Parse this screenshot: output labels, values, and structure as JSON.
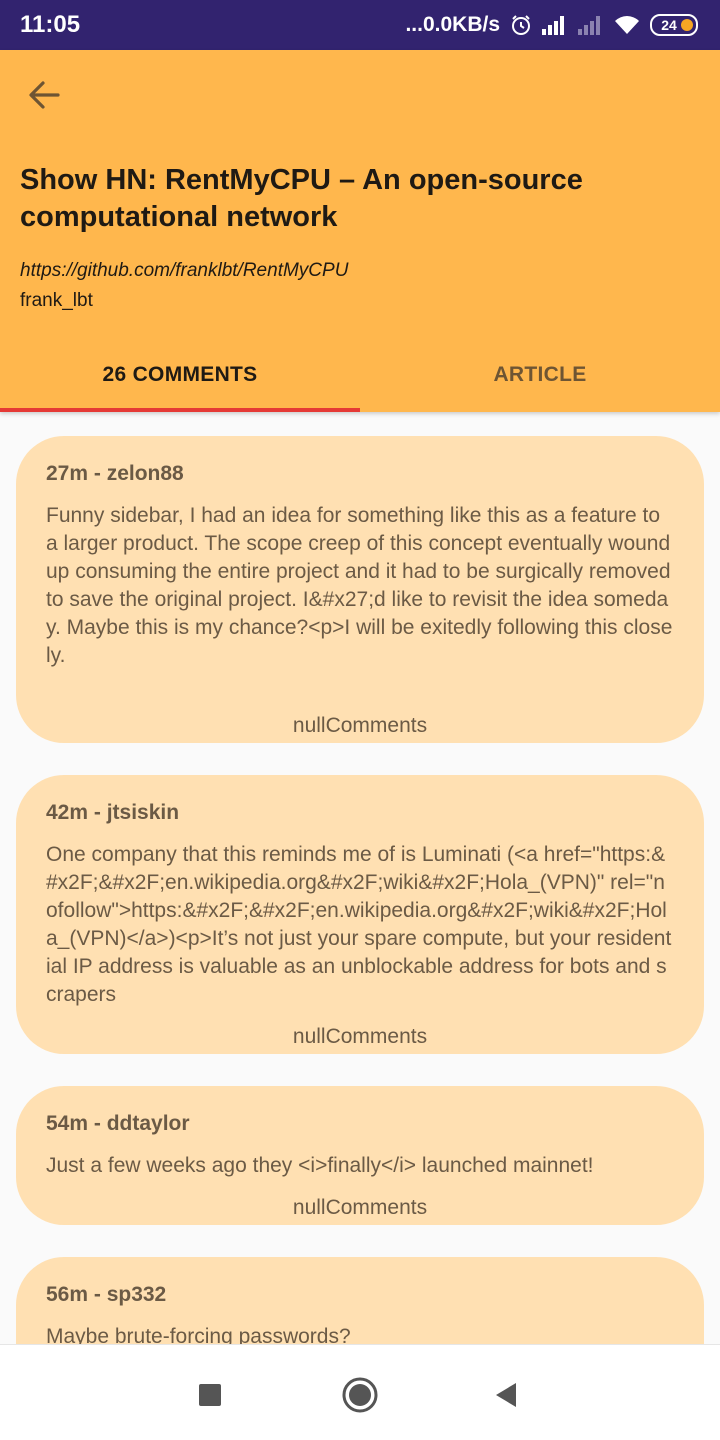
{
  "status_bar": {
    "time": "11:05",
    "network_speed": "...0.0KB/s",
    "battery_level": "24",
    "icons": [
      "alarm-icon",
      "signal-icon",
      "signal-weak-icon",
      "wifi-icon",
      "battery-icon"
    ]
  },
  "header": {
    "back_icon": "arrow-left-icon",
    "title": "Show HN: RentMyCPU – An open-source computational network",
    "url": "https://github.com/franklbt/RentMyCPU",
    "author": "frank_lbt",
    "tabs": [
      {
        "label": "26 COMMENTS",
        "active": true
      },
      {
        "label": "ARTICLE",
        "active": false
      }
    ],
    "colors": {
      "background": "#ffb74d",
      "indicator": "#e53935",
      "status_bar": "#32236f"
    }
  },
  "comments": [
    {
      "meta": "27m - zelon88",
      "body": "Funny sidebar, I had an idea for something like this as a feature to a larger product. The scope creep of this concept eventually wound up consuming the entire project and it had to be surgically removed to save the original project. I&#x27;d like to revisit the idea someday. Maybe this is my chance?<p>I will be exitedly following this closely.",
      "replies": "nullComments"
    },
    {
      "meta": "42m - jtsiskin",
      "body": "One company that this reminds me of is Luminati (<a href=\"https:&#x2F;&#x2F;en.wikipedia.org&#x2F;wiki&#x2F;Hola_(VPN)\" rel=\"nofollow\">https:&#x2F;&#x2F;en.wikipedia.org&#x2F;wiki&#x2F;Hola_(VPN)</a>)<p>It’s not just your spare compute, but your residential IP address is valuable as an unblockable address for bots and scrapers",
      "replies": "nullComments"
    },
    {
      "meta": "54m - ddtaylor",
      "body": "Just a few weeks ago they <i>finally</i> launched mainnet!",
      "replies": "nullComments"
    },
    {
      "meta": "56m - sp332",
      "body": "Maybe brute-forcing passwords?",
      "replies": ""
    }
  ],
  "nav_bar": {
    "icons": [
      "recents-square-icon",
      "home-circle-icon",
      "back-triangle-icon"
    ]
  }
}
